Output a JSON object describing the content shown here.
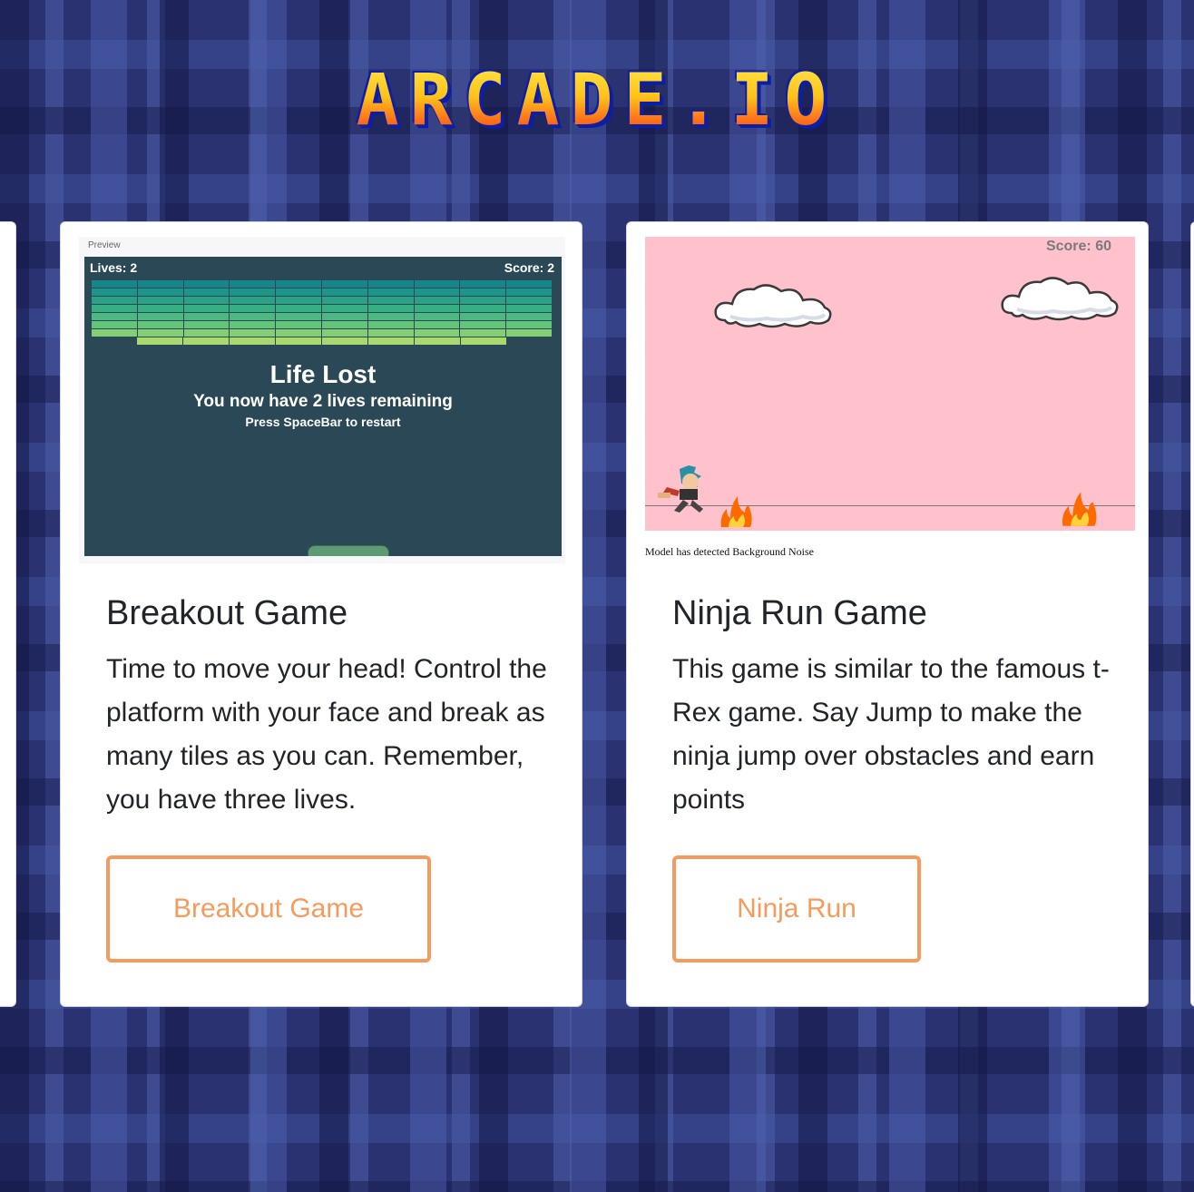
{
  "header": {
    "logo_text": "ARCADE.IO"
  },
  "colors": {
    "accent": "#f69b5b",
    "breakout_bg": "#2a4856",
    "ninja_bg": "#ffc1cc"
  },
  "cards": [
    {
      "preview": {
        "label": "Preview",
        "lives": "Lives: 2",
        "score": "Score: 2",
        "title": "Life Lost",
        "subtitle": "You now have 2 lives remaining",
        "hint": "Press SpaceBar to restart"
      },
      "title": "Breakout Game",
      "text": "Time to move your head! Control the platform with your face and break as many tiles as you can. Remember, you have three lives.",
      "button": "Breakout Game"
    },
    {
      "preview": {
        "score": "Score: 60",
        "caption": "Model has detected Background Noise"
      },
      "title": "Ninja Run Game",
      "text": "This game is similar to the famous t-Rex game. Say Jump to make the ninja jump over obstacles and earn points",
      "button": "Ninja Run"
    }
  ]
}
